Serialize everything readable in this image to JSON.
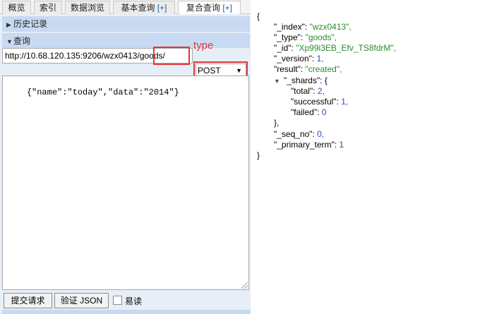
{
  "tabs": [
    {
      "label": "概览"
    },
    {
      "label": "索引"
    },
    {
      "label": "数据浏览"
    },
    {
      "label": "基本查询",
      "plus": "[+]"
    },
    {
      "label": "复合查询",
      "plus": "[+]"
    }
  ],
  "left": {
    "history_header": "历史记录",
    "query_header": "查询",
    "url_value": "http://10.68.120.135:9206/wzx0413/goods/",
    "type_annotation": "type",
    "method_value": "POST",
    "body_value": "{\"name\":\"today\",\"data\":\"2014\"}",
    "submit_label": "提交请求",
    "validate_label": "验证 JSON",
    "readonly_label": "易读"
  },
  "json_view": {
    "open_brace": "{",
    "index_key": "\"_index\":",
    "index_val": "\"wzx0413\",",
    "type_key": "\"_type\":",
    "type_val": "\"goods\",",
    "id_key": "\"_id\":",
    "id_val": "\"Xp99i3EB_Efv_TS8fdrM\",",
    "version_key": "\"_version\":",
    "version_val": "1,",
    "result_key": "\"result\":",
    "result_val": "\"created\",",
    "shards_key": "\"_shards\":",
    "shards_open": "{",
    "total_key": "\"total\":",
    "total_val": "2,",
    "successful_key": "\"successful\":",
    "successful_val": "1,",
    "failed_key": "\"failed\":",
    "failed_val": "0",
    "shards_close": "},",
    "seq_key": "\"_seq_no\":",
    "seq_val": "0,",
    "primary_key": "\"_primary_term\":",
    "primary_val": "1",
    "close_brace": "}"
  },
  "colors": {
    "annotation_red": "#e03a3a",
    "string_green": "#2a8a2a",
    "number_blue": "#1f4fb8",
    "panel_blue": "#e6eef8",
    "header_blue": "#c8daf2"
  }
}
